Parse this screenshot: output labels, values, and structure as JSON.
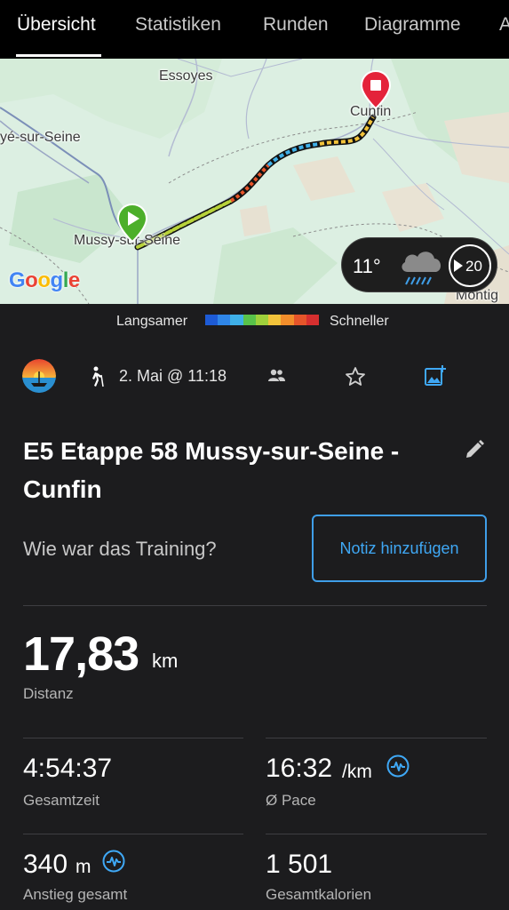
{
  "tabs": [
    {
      "label": "Übersicht",
      "active": true
    },
    {
      "label": "Statistiken",
      "active": false
    },
    {
      "label": "Runden",
      "active": false
    },
    {
      "label": "Diagramme",
      "active": false
    },
    {
      "label": "A",
      "active": false
    }
  ],
  "map": {
    "places": {
      "essoyes": "Essoyes",
      "cunfin": "Cunfin",
      "sur_seine_left": "yé-sur-Seine",
      "mussy": "Mussy-sur-Seine",
      "montig": "Montig"
    },
    "google_logo": [
      "G",
      "o",
      "o",
      "g",
      "l",
      "e"
    ],
    "start_marker_color": "#4caf2a",
    "end_marker_color": "#e4233a"
  },
  "weather": {
    "temperature": "11°",
    "icon": "rain-cloud-icon",
    "timer_value": "20"
  },
  "legend": {
    "slow_label": "Langsamer",
    "fast_label": "Schneller",
    "colors": [
      "#1d5bd6",
      "#2f86e8",
      "#3fb0e8",
      "#58c24a",
      "#9fd03b",
      "#f2c33b",
      "#f28e2b",
      "#e6552a",
      "#d62f2f"
    ]
  },
  "activity": {
    "type_icon": "hiking-icon",
    "date": "2. Mai @ 11:18",
    "title": "E5 Etappe 58 Mussy-sur-Seine - Cunfin",
    "question": "Wie war das Training?",
    "note_button": "Notiz hinzufügen"
  },
  "stats": {
    "distance": {
      "value": "17,83",
      "unit": "km",
      "label": "Distanz"
    },
    "total_time": {
      "value": "4:54:37",
      "label": "Gesamtzeit"
    },
    "pace": {
      "value": "16:32",
      "unit": "/km",
      "label": "Ø Pace"
    },
    "ascent": {
      "value": "340",
      "unit": "m",
      "label": "Anstieg gesamt"
    },
    "calories": {
      "value": "1 501",
      "label": "Gesamtkalorien"
    }
  },
  "colors": {
    "accent_blue": "#3fa8f5",
    "background": "#1c1c1e"
  }
}
